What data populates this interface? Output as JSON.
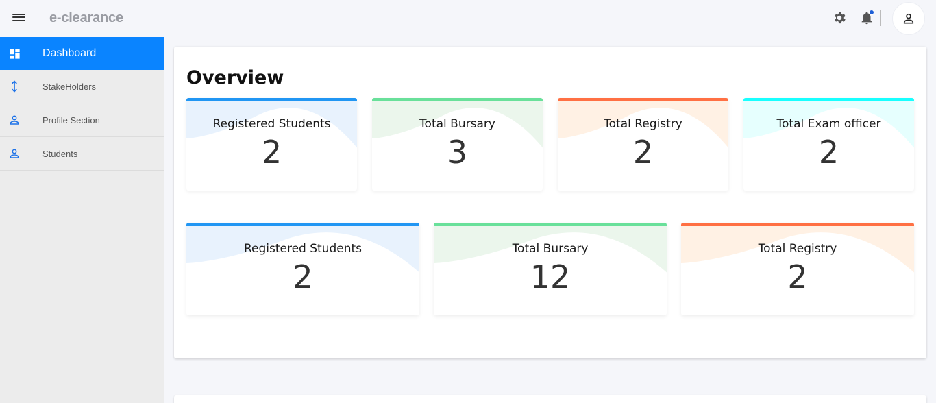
{
  "app": {
    "brand": "e-clearance"
  },
  "header": {
    "menu_icon": "hamburger-icon",
    "settings_icon": "gear-icon",
    "notifications_icon": "bell-icon",
    "profile_icon": "user-icon",
    "notification_dot_color": "#1e5fd6"
  },
  "sidebar": {
    "items": [
      {
        "label": "Dashboard",
        "icon": "dashboard-icon",
        "active": true
      },
      {
        "label": "StakeHolders",
        "icon": "vertical-arrows-icon"
      },
      {
        "label": "Profile Section",
        "icon": "person-icon"
      },
      {
        "label": "Students",
        "icon": "person-icon"
      }
    ],
    "active_color": "#0a84ff"
  },
  "overview": {
    "title": "Overview",
    "row1": [
      {
        "label": "Registered Students",
        "value": "2",
        "color": "#2196f3"
      },
      {
        "label": "Total Bursary",
        "value": "3",
        "color": "#69e09a"
      },
      {
        "label": "Total Registry",
        "value": "2",
        "color": "#ff7043"
      },
      {
        "label": "Total Exam officer",
        "value": "2",
        "color": "#18ffff"
      }
    ],
    "row2": [
      {
        "label": "Registered Students",
        "value": "2",
        "color": "#2196f3"
      },
      {
        "label": "Total Bursary",
        "value": "12",
        "color": "#69e09a"
      },
      {
        "label": "Total Registry",
        "value": "2",
        "color": "#ff7043"
      }
    ]
  }
}
